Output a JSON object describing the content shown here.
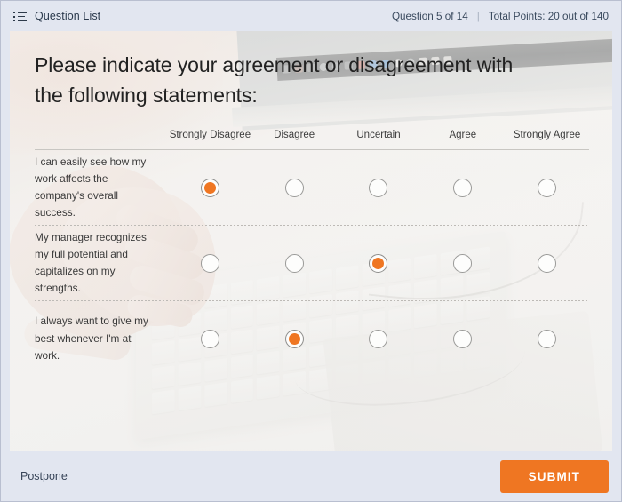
{
  "header": {
    "icon": "list-icon",
    "title": "Question List",
    "progress": "Question 5 of 14",
    "separator": "|",
    "points": "Total Points: 20 out of 140"
  },
  "question": {
    "title": "Please indicate your agreement or disagreement with the following statements:"
  },
  "matrix": {
    "columns": [
      "Strongly Disagree",
      "Disagree",
      "Uncertain",
      "Agree",
      "Strongly Agree"
    ],
    "rows": [
      {
        "label": "I can easily see how my work affects the company's overall success.",
        "selected": 0
      },
      {
        "label": "My manager recognizes my full potential and capitalizes on my strengths.",
        "selected": 2
      },
      {
        "label": "I always want to give my best whenever I'm at work.",
        "selected": 1
      }
    ]
  },
  "footer": {
    "postpone_label": "Postpone",
    "submit_label": "SUBMIT"
  },
  "colors": {
    "accent": "#ef7622",
    "chrome": "#e2e6f0",
    "card": "#f1efed",
    "text": "#2b3a4d"
  }
}
